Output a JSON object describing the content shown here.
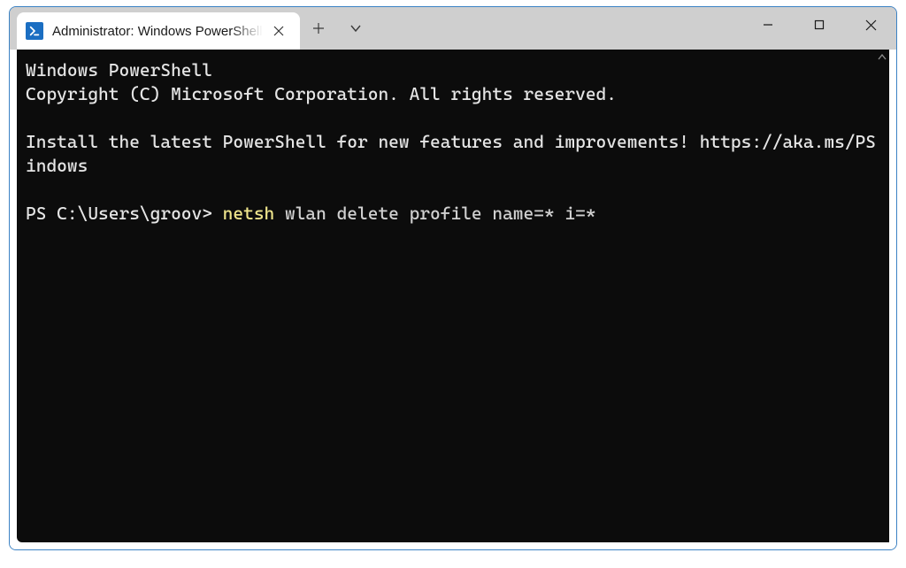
{
  "tab": {
    "title": "Administrator: Windows PowerShell"
  },
  "terminal": {
    "line1": "Windows PowerShell",
    "line2": "Copyright (C) Microsoft Corporation. All rights reserved.",
    "line3": "",
    "line4": "Install the latest PowerShell for new features and improvements! https://aka.ms/PSWindows",
    "line5": "",
    "prompt": "PS C:\\Users\\groov> ",
    "cmd_keyword": "netsh",
    "cmd_rest": " wlan delete profile name=* i=*"
  }
}
